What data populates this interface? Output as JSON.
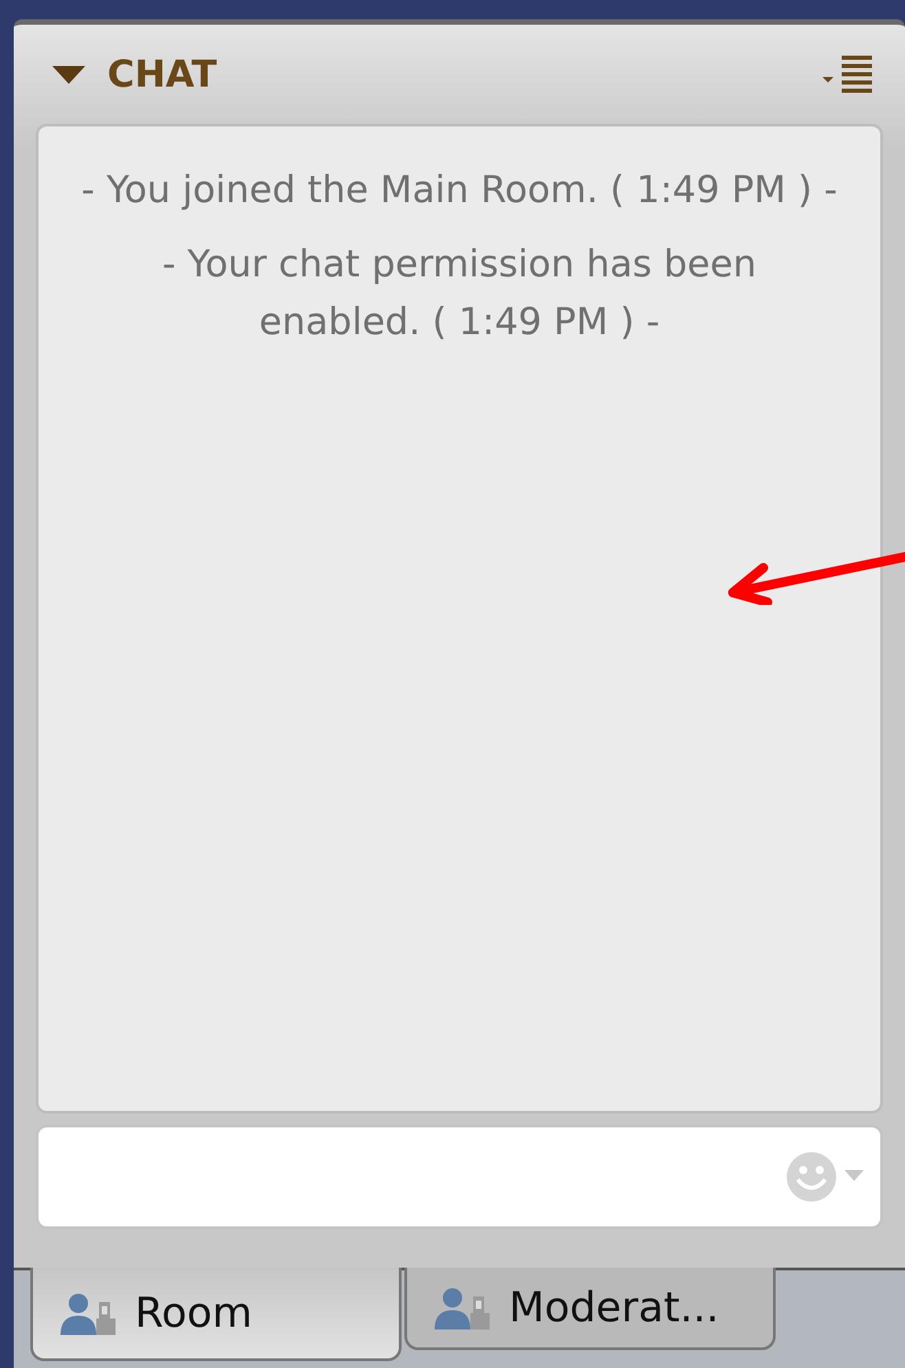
{
  "panel": {
    "title": "CHAT",
    "expanded": true
  },
  "messages": [
    "- You joined the Main Room. ( 1:49 PM ) -",
    "- Your chat permission has been enabled. ( 1:49 PM ) -"
  ],
  "tabs": [
    {
      "label": "Room",
      "selected": true
    },
    {
      "label": "Moderat...",
      "selected": false
    }
  ]
}
